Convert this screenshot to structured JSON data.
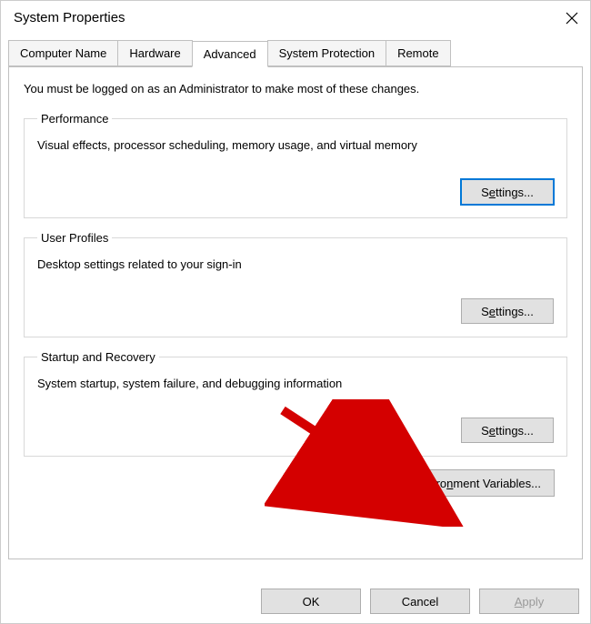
{
  "window": {
    "title": "System Properties"
  },
  "tabs": {
    "computer_name": "Computer Name",
    "hardware": "Hardware",
    "advanced": "Advanced",
    "system_protection": "System Protection",
    "remote": "Remote"
  },
  "advanced": {
    "intro": "You must be logged on as an Administrator to make most of these changes.",
    "performance": {
      "legend": "Performance",
      "desc": "Visual effects, processor scheduling, memory usage, and virtual memory",
      "button_pre": "S",
      "button_u": "e",
      "button_post": "ttings..."
    },
    "user_profiles": {
      "legend": "User Profiles",
      "desc": "Desktop settings related to your sign-in",
      "button_pre": "S",
      "button_u": "e",
      "button_post": "ttings..."
    },
    "startup": {
      "legend": "Startup and Recovery",
      "desc": "System startup, system failure, and debugging information",
      "button_pre": "S",
      "button_u": "e",
      "button_post": "ttings..."
    },
    "env_pre": "Enviro",
    "env_u": "n",
    "env_post": "ment Variables..."
  },
  "footer": {
    "ok": "OK",
    "cancel": "Cancel",
    "apply_u": "A",
    "apply_post": "pply"
  }
}
